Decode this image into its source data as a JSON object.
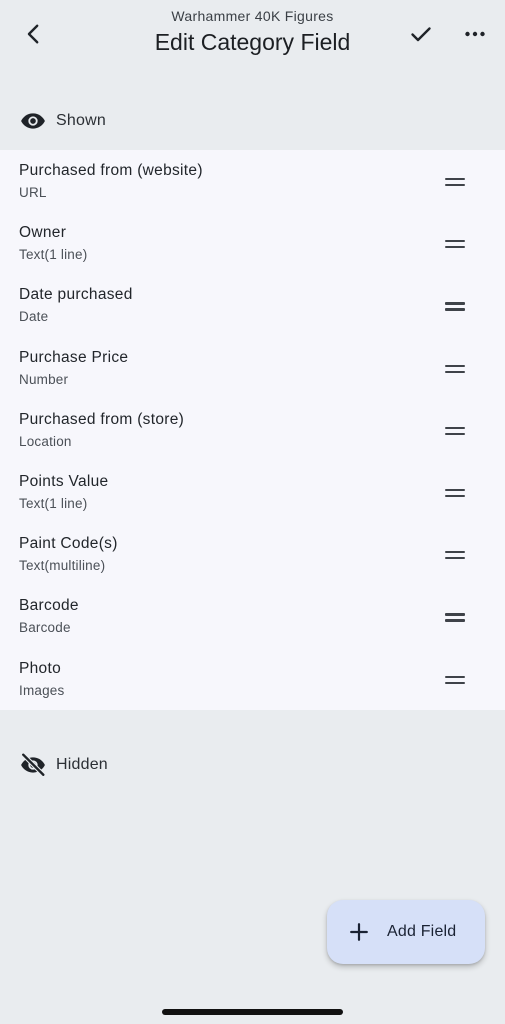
{
  "header": {
    "subtitle": "Warhammer 40K Figures",
    "title": "Edit Category Field",
    "back_icon": "chevron-left-icon",
    "confirm_icon": "checkmark-icon",
    "more_icon": "more-horizontal-icon"
  },
  "sections": {
    "shown": {
      "label": "Shown",
      "icon": "eye-icon"
    },
    "hidden": {
      "label": "Hidden",
      "icon": "eye-off-icon"
    }
  },
  "fields": [
    {
      "name": "Purchased from (website)",
      "type": "URL"
    },
    {
      "name": "Owner",
      "type": "Text(1 line)"
    },
    {
      "name": "Date purchased",
      "type": "Date"
    },
    {
      "name": "Purchase Price",
      "type": "Number"
    },
    {
      "name": "Purchased from (store)",
      "type": "Location"
    },
    {
      "name": "Points Value",
      "type": "Text(1 line)"
    },
    {
      "name": "Paint Code(s)",
      "type": "Text(multiline)"
    },
    {
      "name": "Barcode",
      "type": "Barcode"
    },
    {
      "name": "Photo",
      "type": "Images"
    }
  ],
  "fab": {
    "label": "Add Field",
    "icon": "plus-icon"
  },
  "colors": {
    "background": "#e9ecef",
    "list_background": "#f7f7fc",
    "fab_background": "#d6e0f8"
  }
}
